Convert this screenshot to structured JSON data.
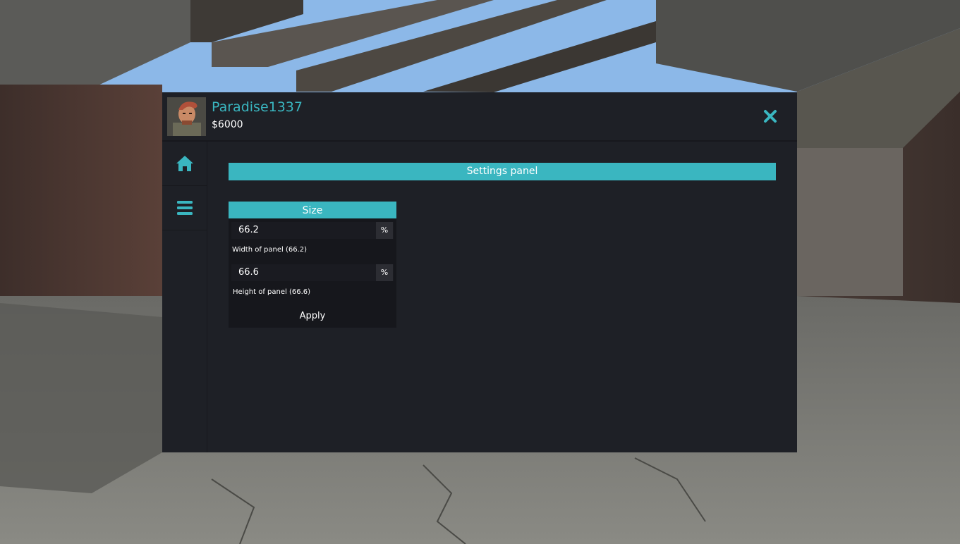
{
  "player": {
    "name": "Paradise1337",
    "money": "$6000"
  },
  "colors": {
    "accent": "#3ab6c0",
    "panel_bg": "#1e2026",
    "box_bg": "#16171c"
  },
  "icons": {
    "close": "close-icon",
    "home": "home-icon",
    "menu": "hamburger-menu-icon"
  },
  "settings": {
    "title": "Settings panel",
    "size_section": {
      "title": "Size",
      "width": {
        "value": "66.2",
        "unit": "%",
        "label": "Width of panel (66.2)"
      },
      "height": {
        "value": "66.6",
        "unit": "%",
        "label": "Height of panel (66.6)"
      },
      "apply_label": "Apply"
    }
  }
}
